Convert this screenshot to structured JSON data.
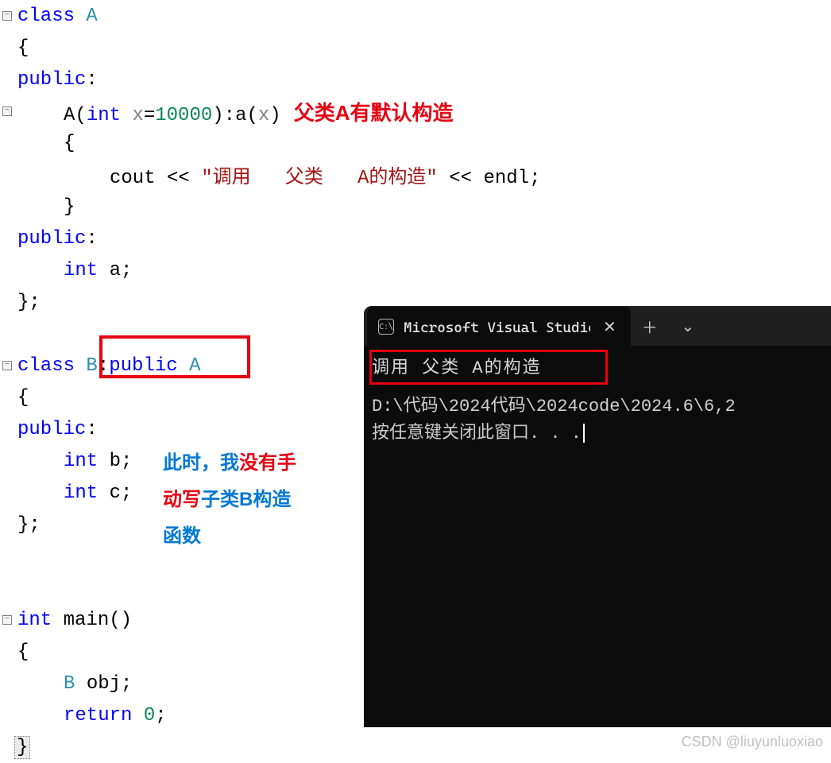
{
  "code": {
    "l1": {
      "kw": "class",
      "sp": " ",
      "type": "A"
    },
    "l2": "{",
    "l3": {
      "kw": "public",
      "colon": ":"
    },
    "l4": {
      "ctor": "A",
      "p1": "(",
      "kw_int": "int",
      "sp": " ",
      "var": "x",
      "eq": "=",
      "num": "10000",
      "p2": "):",
      "mem": "a",
      "p3": "(",
      "arg": "x",
      "p4": ")"
    },
    "l5": "{",
    "l6": {
      "cout": "cout",
      "op1": " << ",
      "str": "\"调用   父类   A的构造\"",
      "op2": " << ",
      "endl": "endl",
      "semi": ";"
    },
    "l7": "}",
    "l8": {
      "kw": "public",
      "colon": ":"
    },
    "l9": {
      "kw_int": "int",
      "sp": " ",
      "var": "a",
      "semi": ";"
    },
    "l10": "};",
    "l11": {
      "kw": "class",
      "sp": " ",
      "type": "B",
      "colon": ":",
      "kw2": "public",
      "sp2": " ",
      "base": "A"
    },
    "l12": "{",
    "l13": {
      "kw": "public",
      "colon": ":"
    },
    "l14": {
      "kw_int": "int",
      "sp": " ",
      "var": "b",
      "semi": ";"
    },
    "l15": {
      "kw_int": "int",
      "sp": " ",
      "var": "c",
      "semi": ";"
    },
    "l16": "};",
    "l17": {
      "kw_int": "int",
      "sp": " ",
      "fn": "main",
      "p": "()"
    },
    "l18": "{",
    "l19": {
      "type": "B",
      "sp": " ",
      "var": "obj",
      "semi": ";"
    },
    "l20": {
      "kw": "return",
      "sp": " ",
      "num": "0",
      "semi": ";"
    },
    "l21": "}"
  },
  "annotations": {
    "defaultCtor": "父类A有默认构造",
    "mixed": {
      "p1": "此时，我",
      "p2": "没有手",
      "p3": "动写",
      "p4": "子类B构造",
      "p5": "函数"
    }
  },
  "terminal": {
    "tabTitle": "Microsoft Visual Studio 调试控",
    "iconLabel": "C:\\",
    "output1": "调用   父类   A的构造",
    "path": "D:\\代码\\2024代码\\2024code\\2024.6\\6,2",
    "pressKey": "按任意键关闭此窗口. . .",
    "plus": "＋",
    "chev": "⌄"
  },
  "watermark": "CSDN @liuyunluoxiao",
  "foldGlyph": "−"
}
